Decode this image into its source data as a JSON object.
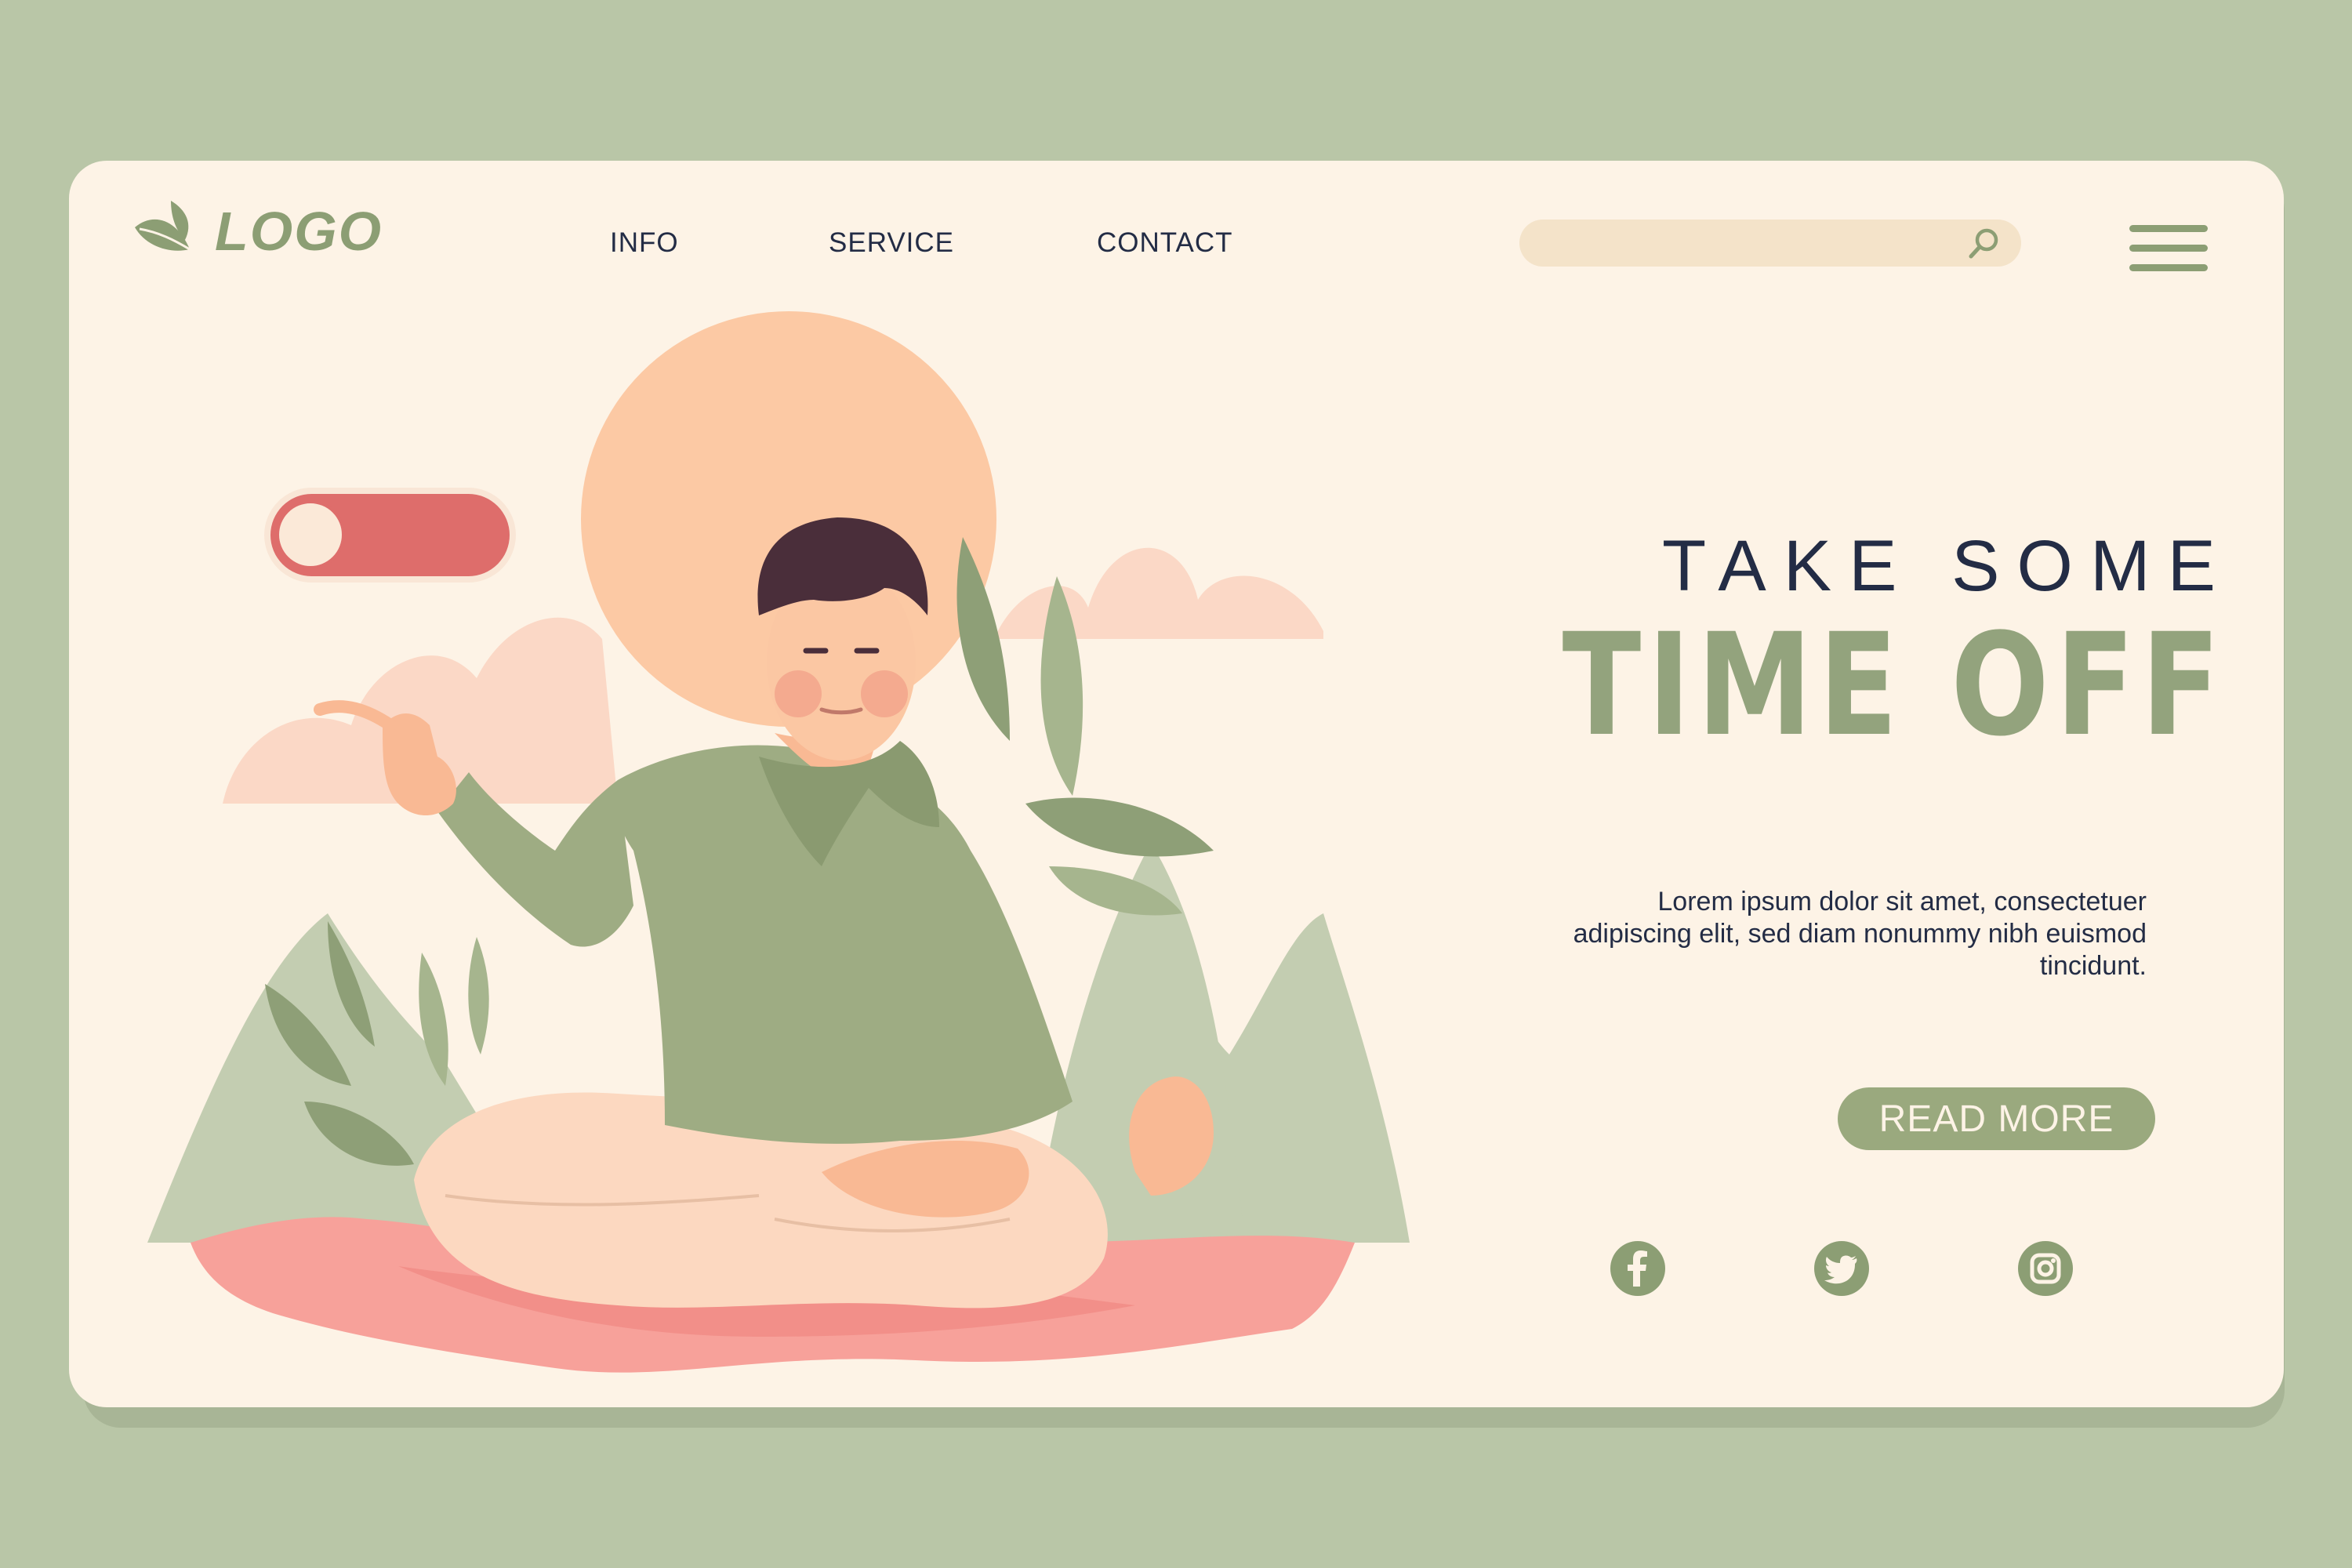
{
  "header": {
    "logo_text": "LOGO",
    "nav": [
      {
        "label": "INFO"
      },
      {
        "label": "SERVICE"
      },
      {
        "label": "CONTACT"
      }
    ],
    "search": {
      "value": "",
      "placeholder": "",
      "icon": "search-icon"
    },
    "menu_icon": "hamburger-menu-icon"
  },
  "illustration": {
    "toggle_state": "off",
    "toggle_color": "#de6d6b"
  },
  "hero": {
    "kicker": "TAKE SOME",
    "title": "TIME OFF",
    "body": "Lorem ipsum dolor sit amet, consectetuer adipiscing elit, sed diam nonummy nibh euismod tincidunt.",
    "cta_label": "READ MORE"
  },
  "social": [
    {
      "icon": "facebook-icon"
    },
    {
      "icon": "twitter-icon"
    },
    {
      "icon": "instagram-icon"
    }
  ],
  "colors": {
    "background": "#b9c6a7",
    "card": "#fdf3e6",
    "accent_green": "#8c9e74",
    "navy": "#232c45",
    "coral": "#de6d6b"
  }
}
